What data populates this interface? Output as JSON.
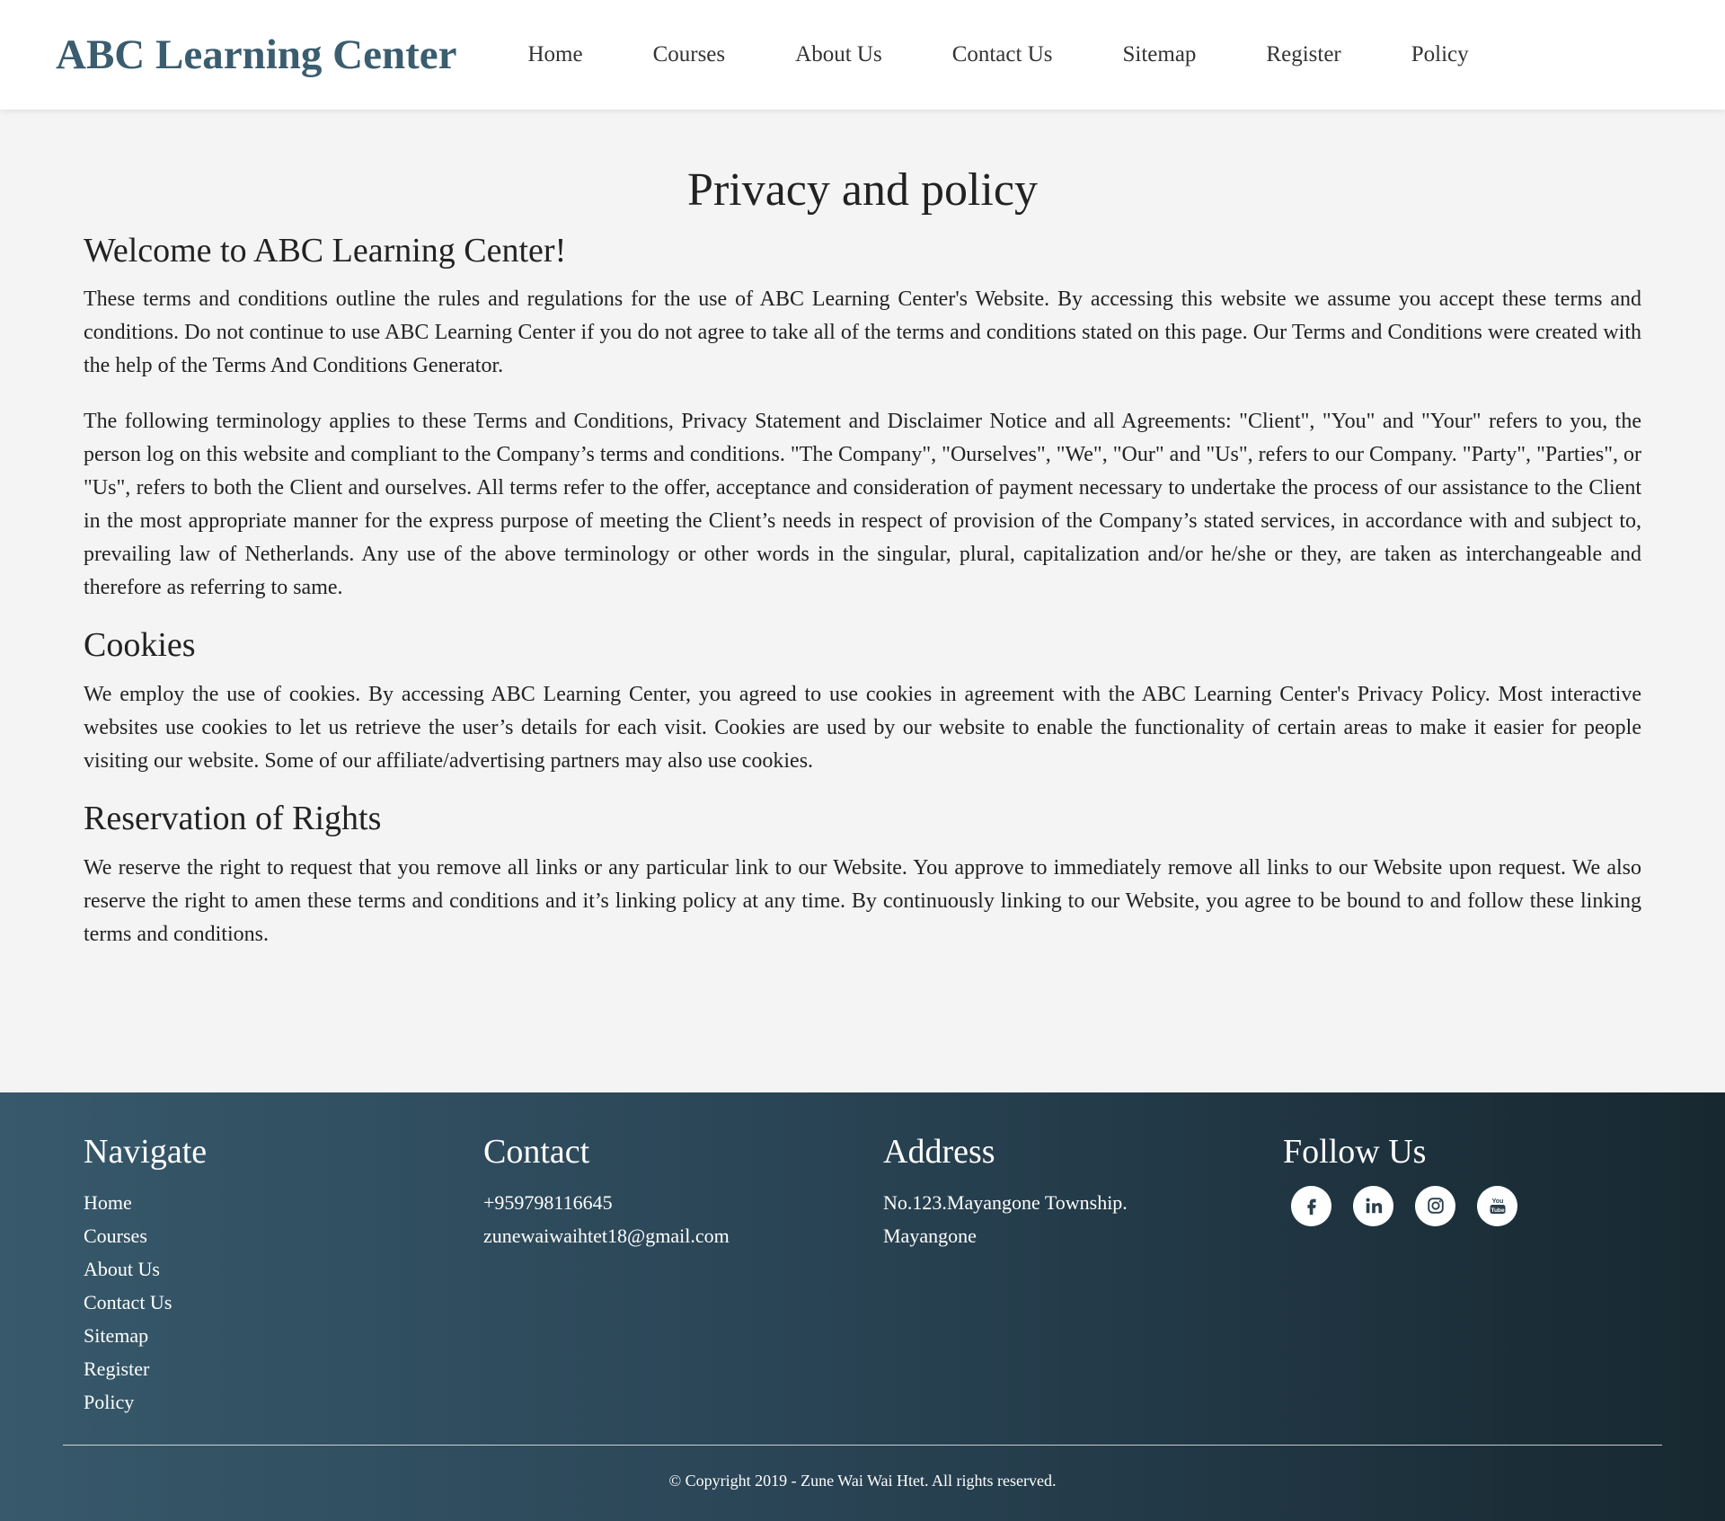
{
  "header": {
    "brand": "ABC Learning Center",
    "nav": [
      "Home",
      "Courses",
      "About Us",
      "Contact Us",
      "Sitemap",
      "Register",
      "Policy"
    ]
  },
  "main": {
    "title": "Privacy and policy",
    "welcome_heading": "Welcome to ABC Learning Center!",
    "p1": "These terms and conditions outline the rules and regulations for the use of ABC Learning Center's Website. By accessing this website we assume you accept these terms and conditions. Do not continue to use ABC Learning Center if you do not agree to take all of the terms and conditions stated on this page. Our Terms and Conditions were created with the help of the Terms And Conditions Generator.",
    "p2": "The following terminology applies to these Terms and Conditions, Privacy Statement and Disclaimer Notice and all Agreements: \"Client\", \"You\" and \"Your\" refers to you, the person log on this website and compliant to the Company’s terms and conditions. \"The Company\", \"Ourselves\", \"We\", \"Our\" and \"Us\", refers to our Company. \"Party\", \"Parties\", or \"Us\", refers to both the Client and ourselves. All terms refer to the offer, acceptance and consideration of payment necessary to undertake the process of our assistance to the Client in the most appropriate manner for the express purpose of meeting the Client’s needs in respect of provision of the Company’s stated services, in accordance with and subject to, prevailing law of Netherlands. Any use of the above terminology or other words in the singular, plural, capitalization and/or he/she or they, are taken as interchangeable and therefore as referring to same.",
    "cookies_heading": "Cookies",
    "cookies_text": "We employ the use of cookies. By accessing ABC Learning Center, you agreed to use cookies in agreement with the ABC Learning Center's Privacy Policy. Most interactive websites use cookies to let us retrieve the user’s details for each visit. Cookies are used by our website to enable the functionality of certain areas to make it easier for people visiting our website. Some of our affiliate/advertising partners may also use cookies.",
    "rights_heading": "Reservation of Rights",
    "rights_text": "We reserve the right to request that you remove all links or any particular link to our Website. You approve to immediately remove all links to our Website upon request. We also reserve the right to amen these terms and conditions and it’s linking policy at any time. By continuously linking to our Website, you agree to be bound to and follow these linking terms and conditions."
  },
  "footer": {
    "navigate_heading": "Navigate",
    "navigate_links": [
      "Home",
      "Courses",
      "About Us",
      "Contact Us",
      "Sitemap",
      "Register",
      "Policy"
    ],
    "contact_heading": "Contact",
    "phone": "+959798116645",
    "email": "zunewaiwaihtet18@gmail.com",
    "address_heading": "Address",
    "address_line1": "No.123.Mayangone Township.",
    "address_line2": "Mayangone",
    "follow_heading": "Follow Us",
    "social_icons": [
      "facebook-icon",
      "linkedin-icon",
      "instagram-icon",
      "youtube-icon"
    ],
    "copyright": "© Copyright 2019 - Zune Wai Wai Htet. All rights reserved."
  },
  "colors": {
    "brand": "#3a5d6f",
    "footer_start": "#37596b",
    "footer_end": "#172830",
    "page_bg": "#f4f4f4"
  }
}
